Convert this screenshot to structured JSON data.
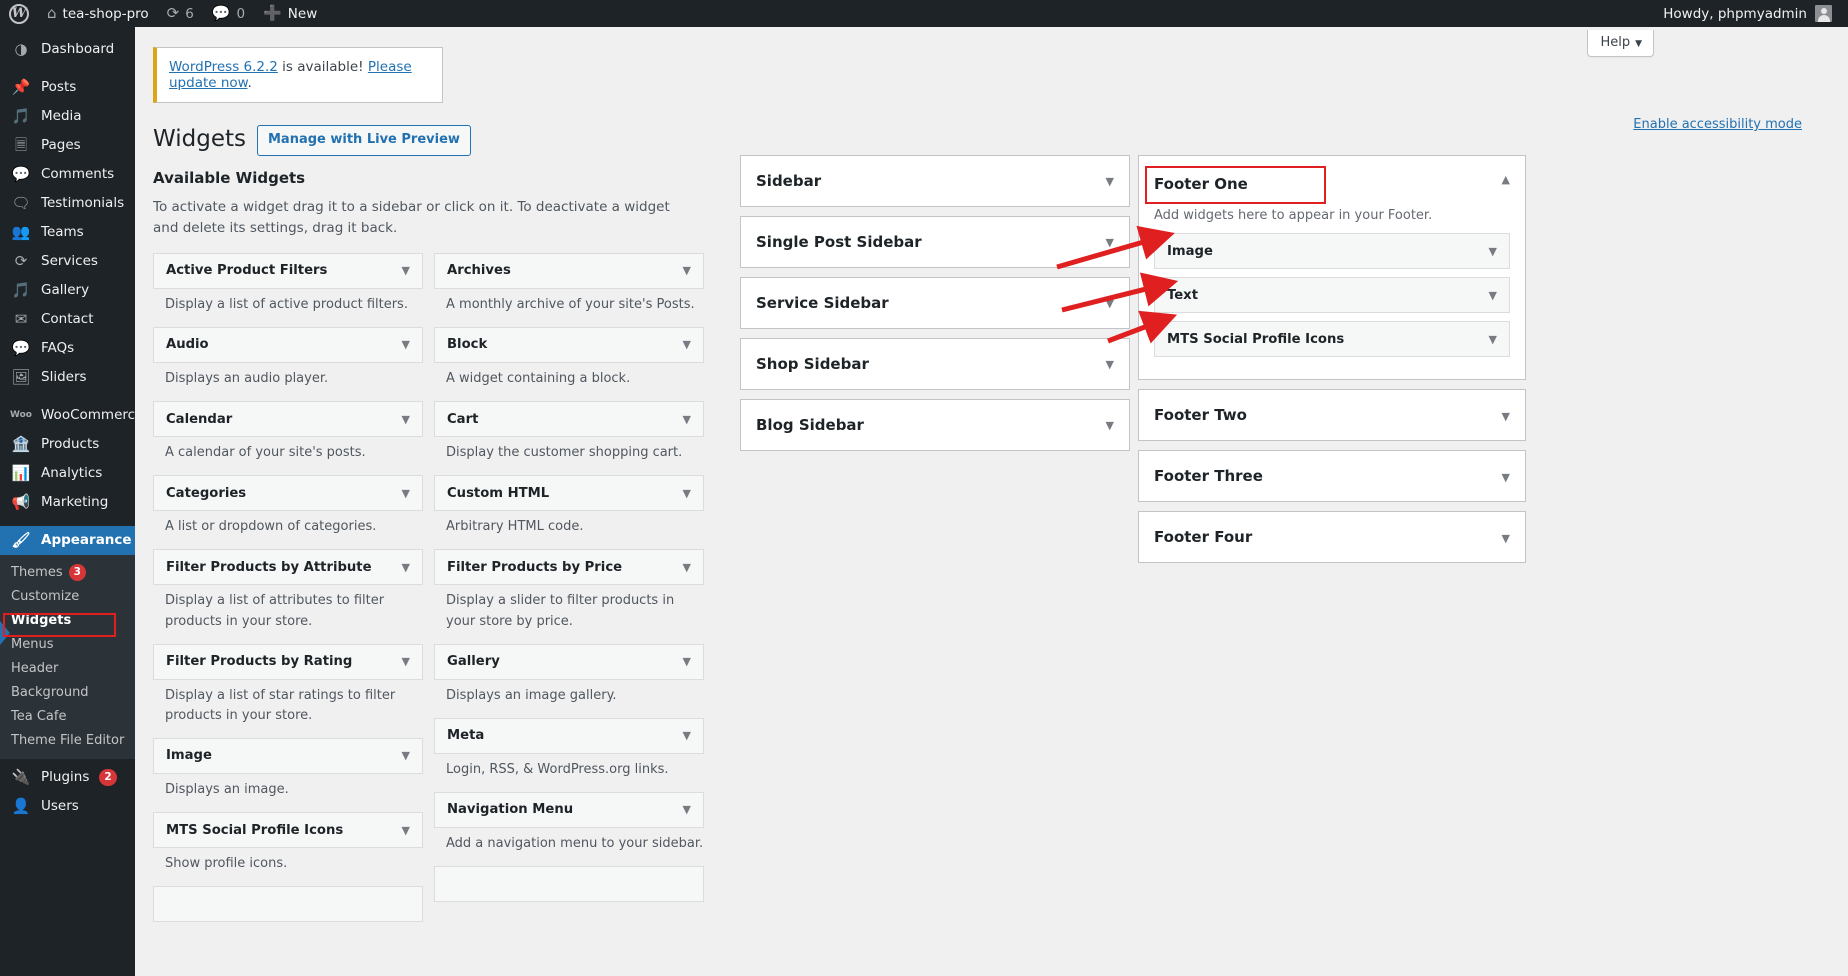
{
  "adminbar": {
    "logo_icon": "wordpress-logo-icon",
    "site_icon": "home-icon",
    "site_name": "tea-shop-pro",
    "updates_icon": "updates-icon",
    "updates_count": "6",
    "comments_icon": "comment-icon",
    "comments_count": "0",
    "new_icon": "plus-icon",
    "new_label": "New",
    "howdy": "Howdy, phpmyadmin",
    "avatar_name": "avatar"
  },
  "sidebar": {
    "items": [
      {
        "label": "Dashboard",
        "icon": "dashboard-icon"
      },
      {
        "label": "Posts",
        "icon": "pin-icon"
      },
      {
        "label": "Media",
        "icon": "media-icon"
      },
      {
        "label": "Pages",
        "icon": "pages-icon"
      },
      {
        "label": "Comments",
        "icon": "comment-icon"
      },
      {
        "label": "Testimonials",
        "icon": "testimonials-icon"
      },
      {
        "label": "Teams",
        "icon": "teams-icon"
      },
      {
        "label": "Services",
        "icon": "services-icon"
      },
      {
        "label": "Gallery",
        "icon": "gallery-icon"
      },
      {
        "label": "Contact",
        "icon": "envelope-icon"
      },
      {
        "label": "FAQs",
        "icon": "faq-icon"
      },
      {
        "label": "Sliders",
        "icon": "sliders-icon"
      },
      {
        "label": "WooCommerce",
        "icon": "woocommerce-icon"
      },
      {
        "label": "Products",
        "icon": "products-icon"
      },
      {
        "label": "Analytics",
        "icon": "analytics-icon"
      },
      {
        "label": "Marketing",
        "icon": "marketing-icon"
      },
      {
        "label": "Appearance",
        "icon": "appearance-icon"
      }
    ],
    "appearance_submenu": [
      {
        "label": "Themes",
        "badge": "3"
      },
      {
        "label": "Customize",
        "badge": ""
      },
      {
        "label": "Widgets",
        "badge": ""
      },
      {
        "label": "Menus",
        "badge": ""
      },
      {
        "label": "Header",
        "badge": ""
      },
      {
        "label": "Background",
        "badge": ""
      },
      {
        "label": "Tea Cafe",
        "badge": ""
      },
      {
        "label": "Theme File Editor",
        "badge": ""
      }
    ],
    "plugins": {
      "label": "Plugins",
      "icon": "plugins-icon",
      "badge": "2"
    },
    "users": {
      "label": "Users",
      "icon": "users-icon"
    },
    "collapse_icon": "collapse-menu-arrow-icon"
  },
  "header": {
    "help_label": "Help",
    "help_caret": "▼",
    "notice_link_1": "WordPress 6.2.2",
    "notice_mid": " is available! ",
    "notice_link_2": "Please update now",
    "notice_end": ".",
    "accessibility_link": "Enable accessibility mode",
    "page_title": "Widgets",
    "live_preview_label": "Manage with Live Preview"
  },
  "available": {
    "title": "Available Widgets",
    "description": "To activate a widget drag it to a sidebar or click on it. To deactivate a widget and delete its settings, drag it back.",
    "caret": "▼",
    "left_column": [
      {
        "name": "Active Product Filters",
        "desc": "Display a list of active product filters."
      },
      {
        "name": "Audio",
        "desc": "Displays an audio player."
      },
      {
        "name": "Calendar",
        "desc": "A calendar of your site's posts."
      },
      {
        "name": "Categories",
        "desc": "A list or dropdown of categories."
      },
      {
        "name": "Filter Products by Attribute",
        "desc": "Display a list of attributes to filter products in your store."
      },
      {
        "name": "Filter Products by Rating",
        "desc": "Display a list of star ratings to filter products in your store."
      },
      {
        "name": "Image",
        "desc": "Displays an image."
      },
      {
        "name": "MTS Social Profile Icons",
        "desc": "Show profile icons."
      }
    ],
    "right_column": [
      {
        "name": "Archives",
        "desc": "A monthly archive of your site's Posts."
      },
      {
        "name": "Block",
        "desc": "A widget containing a block."
      },
      {
        "name": "Cart",
        "desc": "Display the customer shopping cart."
      },
      {
        "name": "Custom HTML",
        "desc": "Arbitrary HTML code."
      },
      {
        "name": "Filter Products by Price",
        "desc": "Display a slider to filter products in your store by price."
      },
      {
        "name": "Gallery",
        "desc": "Displays an image gallery."
      },
      {
        "name": "Meta",
        "desc": "Login, RSS, & WordPress.org links."
      },
      {
        "name": "Navigation Menu",
        "desc": "Add a navigation menu to your sidebar."
      }
    ]
  },
  "sidebars_column": {
    "caret": "▼",
    "panels": [
      {
        "title": "Sidebar"
      },
      {
        "title": "Single Post Sidebar"
      },
      {
        "title": "Service Sidebar"
      },
      {
        "title": "Shop Sidebar"
      },
      {
        "title": "Blog Sidebar"
      }
    ]
  },
  "footers_column": {
    "caret_down": "▼",
    "caret_up": "▲",
    "footer_one": {
      "title": "Footer One",
      "desc": "Add widgets here to appear in your Footer.",
      "widgets": [
        {
          "name": "Image"
        },
        {
          "name": "Text"
        },
        {
          "name": "MTS Social Profile Icons"
        }
      ]
    },
    "collapsed": [
      {
        "title": "Footer Two"
      },
      {
        "title": "Footer Three"
      },
      {
        "title": "Footer Four"
      }
    ]
  },
  "annotations": {
    "highlight_color": "#e02020",
    "arrow_color": "#e02020",
    "highlight_targets": [
      "sidebar-item-widgets",
      "footer-one-title"
    ],
    "arrow_targets": [
      "footer-widget-image",
      "footer-widget-text",
      "footer-widget-mts-social-profile-icons"
    ]
  }
}
